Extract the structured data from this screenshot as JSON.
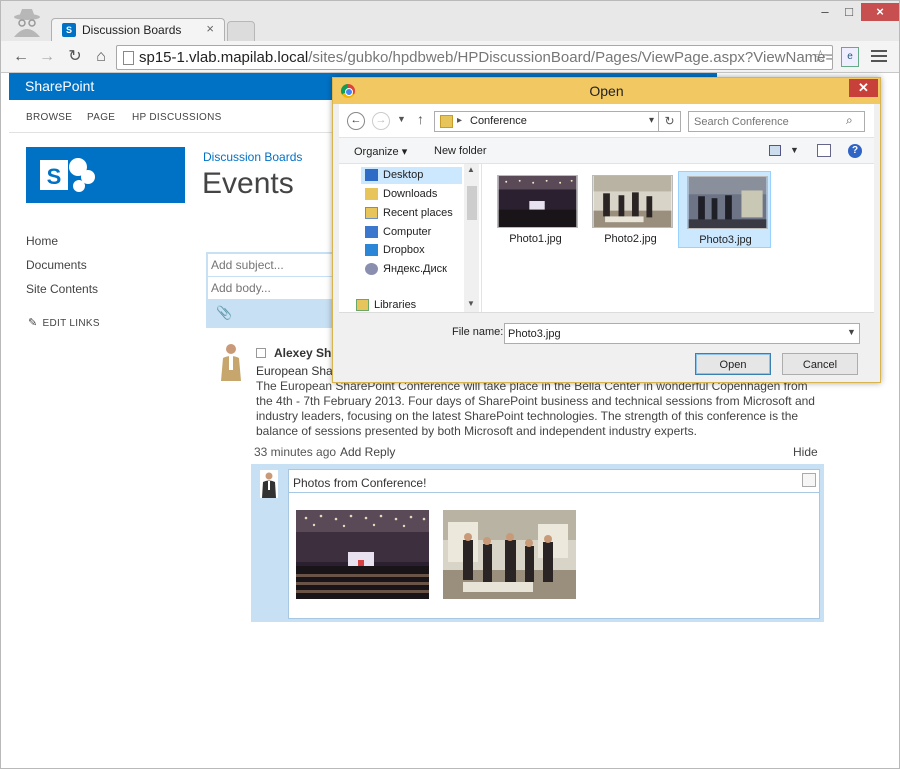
{
  "browser": {
    "tab_title": "Discussion Boards",
    "url_host": "sp15-1.vlab.mapilab.local",
    "url_path": "/sites/gubko/hpdbweb/HPDiscussionBoard/Pages/ViewPage.aspx?ViewName=Tree8"
  },
  "sharepoint": {
    "brand": "SharePoint",
    "ribbon_tabs": [
      "BROWSE",
      "PAGE",
      "HP DISCUSSIONS"
    ],
    "breadcrumb": "Discussion Boards",
    "page_title": "Events",
    "quick_launch": [
      "Home",
      "Documents",
      "Site Contents"
    ],
    "edit_links": "EDIT LINKS",
    "accent": "#0072c6"
  },
  "compose": {
    "subject_placeholder": "Add subject...",
    "body_placeholder": "Add body..."
  },
  "post": {
    "author": "Alexey Shl",
    "subject": "European Shar",
    "body": "The European SharePoint Conference will take place in the Bella Center in wonderful Copenhagen from the 4th - 7th February 2013. Four days of SharePoint business and technical sessions from Microsoft and industry leaders, focusing on the latest SharePoint technologies. The strength of this conference is the balance of sessions presented by both Microsoft and independent industry experts.",
    "time": "33 minutes ago",
    "reply_label": "Add Reply",
    "hide_label": "Hide"
  },
  "reply": {
    "subject": "Photos from Conference!"
  },
  "dialog": {
    "title": "Open",
    "path": "Conference",
    "search_placeholder": "Search Conference",
    "organize": "Organize",
    "new_folder": "New folder",
    "tree": [
      "Desktop",
      "Downloads",
      "Recent places",
      "Computer",
      "Dropbox",
      "Яндекс.Диск",
      "Libraries"
    ],
    "files": [
      "Photo1.jpg",
      "Photo2.jpg",
      "Photo3.jpg"
    ],
    "filename_label": "File name:",
    "filename_value": "Photo3.jpg",
    "open_button": "Open",
    "cancel_button": "Cancel",
    "title_color": "#f2c862"
  }
}
